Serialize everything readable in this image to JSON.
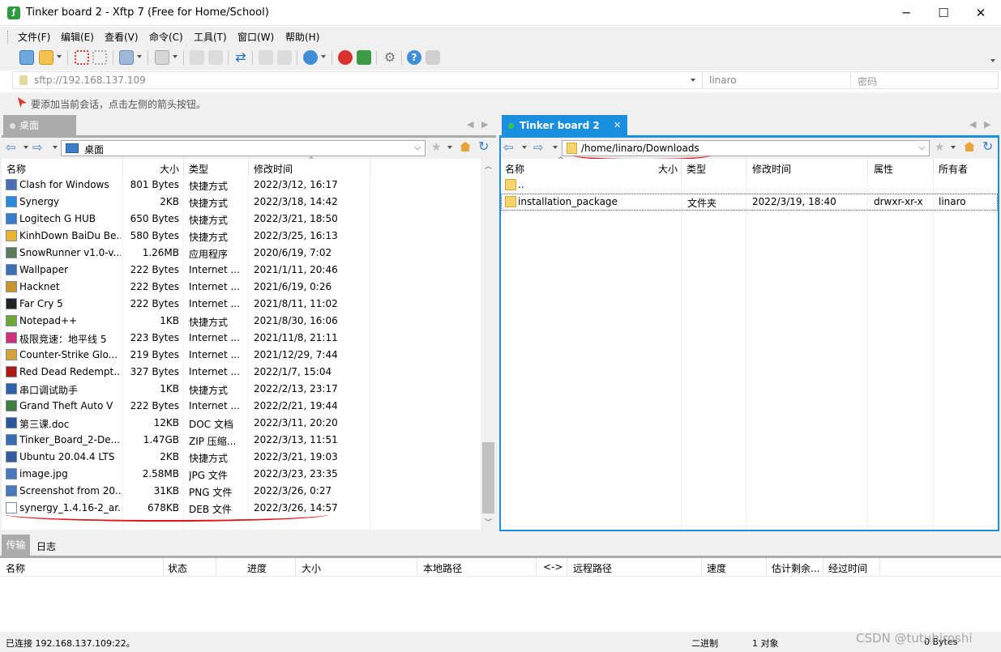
{
  "window": {
    "title": "Tinker board 2 - Xftp 7 (Free for Home/School)",
    "app_icon": "xftp-icon",
    "minimize": "─",
    "maximize": "☐",
    "close": "✕"
  },
  "menu": [
    "文件(F)",
    "编辑(E)",
    "查看(V)",
    "命令(C)",
    "工具(T)",
    "窗口(W)",
    "帮助(H)"
  ],
  "address": {
    "url": "sftp://192.168.137.109",
    "user": "linaro",
    "password_placeholder": "密码"
  },
  "hint": "要添加当前会话，点击左侧的箭头按钮。",
  "left": {
    "tab": "桌面",
    "path": "桌面",
    "columns": [
      "名称",
      "大小",
      "类型",
      "修改时间"
    ],
    "rows": [
      {
        "name": "Clash for Windows",
        "size": "801 Bytes",
        "type": "快捷方式",
        "mtime": "2022/3/12, 16:17",
        "icon": "shortcut",
        "color": "#4a6fb5"
      },
      {
        "name": "Synergy",
        "size": "2KB",
        "type": "快捷方式",
        "mtime": "2022/3/18, 14:42",
        "icon": "shortcut",
        "color": "#2c8ad8"
      },
      {
        "name": "Logitech G HUB",
        "size": "650 Bytes",
        "type": "快捷方式",
        "mtime": "2022/3/21, 18:50",
        "icon": "shortcut",
        "color": "#3b7dc4"
      },
      {
        "name": "KinhDown BaiDu Be...",
        "size": "580 Bytes",
        "type": "快捷方式",
        "mtime": "2022/3/25, 16:13",
        "icon": "shortcut",
        "color": "#e9b330"
      },
      {
        "name": "SnowRunner v1.0-v...",
        "size": "1.26MB",
        "type": "应用程序",
        "mtime": "2020/6/19, 7:02",
        "icon": "app",
        "color": "#5a7a5a"
      },
      {
        "name": "Wallpaper",
        "size": "222 Bytes",
        "type": "Internet ...",
        "mtime": "2021/1/11, 20:46",
        "icon": "internet",
        "color": "#3d6fb0"
      },
      {
        "name": "Hacknet",
        "size": "222 Bytes",
        "type": "Internet ...",
        "mtime": "2021/6/19, 0:26",
        "icon": "internet",
        "color": "#c9952d"
      },
      {
        "name": "Far Cry 5",
        "size": "222 Bytes",
        "type": "Internet ...",
        "mtime": "2021/8/11, 11:02",
        "icon": "internet",
        "color": "#222222"
      },
      {
        "name": "Notepad++",
        "size": "1KB",
        "type": "快捷方式",
        "mtime": "2021/8/30, 16:06",
        "icon": "shortcut",
        "color": "#6ea83a"
      },
      {
        "name": "极限竞速：地平线 5",
        "size": "223 Bytes",
        "type": "Internet ...",
        "mtime": "2021/11/8, 21:11",
        "icon": "internet",
        "color": "#d0307a"
      },
      {
        "name": "Counter-Strike Glo...",
        "size": "219 Bytes",
        "type": "Internet ...",
        "mtime": "2021/12/29, 7:44",
        "icon": "internet",
        "color": "#d4a23a"
      },
      {
        "name": "Red Dead Redempt...",
        "size": "327 Bytes",
        "type": "Internet ...",
        "mtime": "2022/1/7, 15:04",
        "icon": "internet",
        "color": "#b01818"
      },
      {
        "name": "串口调试助手",
        "size": "1KB",
        "type": "快捷方式",
        "mtime": "2022/2/13, 23:17",
        "icon": "shortcut",
        "color": "#2f5fa8"
      },
      {
        "name": "Grand Theft Auto V",
        "size": "222 Bytes",
        "type": "Internet ...",
        "mtime": "2022/2/21, 19:44",
        "icon": "internet",
        "color": "#3e7d3e"
      },
      {
        "name": "第三课.doc",
        "size": "12KB",
        "type": "DOC 文档",
        "mtime": "2022/3/11, 20:20",
        "icon": "doc",
        "color": "#2b579a"
      },
      {
        "name": "Tinker_Board_2-De...",
        "size": "1.47GB",
        "type": "ZIP 压缩...",
        "mtime": "2022/3/13, 11:51",
        "icon": "zip",
        "color": "#3a6cb4"
      },
      {
        "name": "Ubuntu 20.04.4 LTS",
        "size": "2KB",
        "type": "快捷方式",
        "mtime": "2022/3/21, 19:03",
        "icon": "shortcut",
        "color": "#355b9a"
      },
      {
        "name": "image.jpg",
        "size": "2.58MB",
        "type": "JPG 文件",
        "mtime": "2022/3/23, 23:35",
        "icon": "image",
        "color": "#4a78b8"
      },
      {
        "name": "Screenshot from 20...",
        "size": "31KB",
        "type": "PNG 文件",
        "mtime": "2022/3/26, 0:27",
        "icon": "image",
        "color": "#4a78b8"
      },
      {
        "name": "synergy_1.4.16-2_ar...",
        "size": "678KB",
        "type": "DEB 文件",
        "mtime": "2022/3/26, 14:57",
        "icon": "file",
        "color": "#ffffff"
      }
    ]
  },
  "right": {
    "tab": "Tinker board 2",
    "path": "/home/linaro/Downloads",
    "columns": [
      "名称",
      "大小",
      "类型",
      "修改时间",
      "属性",
      "所有者"
    ],
    "rows": [
      {
        "name": "..",
        "size": "",
        "type": "",
        "mtime": "",
        "perm": "",
        "owner": ""
      },
      {
        "name": "installation_package",
        "size": "",
        "type": "文件夹",
        "mtime": "2022/3/19, 18:40",
        "perm": "drwxr-xr-x",
        "owner": "linaro"
      }
    ]
  },
  "transfer": {
    "tabs": [
      "传输",
      "日志"
    ],
    "columns": [
      "名称",
      "状态",
      "进度",
      "大小",
      "本地路径",
      "<->",
      "远程路径",
      "速度",
      "估计剩余...",
      "经过时间"
    ]
  },
  "status": {
    "connected": "已连接 192.168.137.109:22。",
    "mode": "二进制",
    "objects": "1 对象",
    "bytes": "0 Bytes"
  },
  "watermark": "CSDN @tutuhiroshi"
}
